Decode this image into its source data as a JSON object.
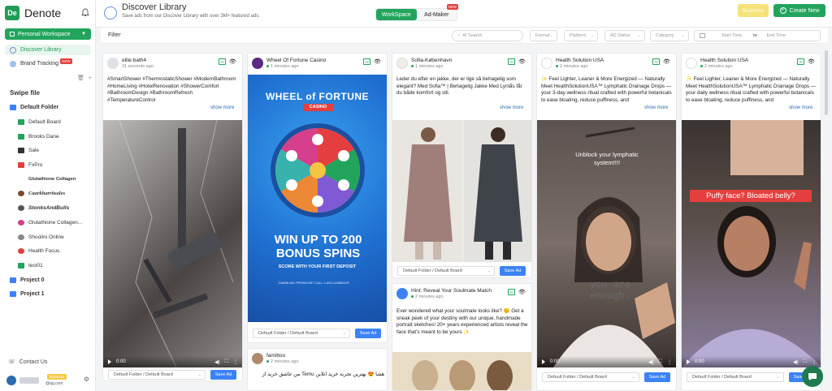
{
  "app": {
    "name": "Denote",
    "logo_text": "De"
  },
  "sidebar": {
    "workspace": "Personal Workspace",
    "nav": [
      {
        "label": "Discover Library",
        "active": true
      },
      {
        "label": "Brand Tracking",
        "badge": "NEW"
      }
    ],
    "swipe_title": "Swipe file",
    "folders": [
      {
        "label": "Default Folder",
        "bold": true,
        "color": "#3b82f6"
      },
      {
        "label": "Default Board",
        "color": "#22a45d"
      },
      {
        "label": "Brooks Dane",
        "color": "#22a45d"
      },
      {
        "label": "Sale",
        "color": "#333333"
      },
      {
        "label": "FxPro",
        "color": "#e53e3e"
      },
      {
        "label": "Glutathione Collagen",
        "color": "#ffffff"
      },
      {
        "label": "Caarkharritsales",
        "color": "#7c4a2d"
      },
      {
        "label": "StonksAndBulls",
        "color": "#555555"
      },
      {
        "label": "Glutathione Collagen...",
        "color": "#d53f8c"
      },
      {
        "label": "Shoolini Online",
        "color": "#888888"
      },
      {
        "label": "Health Focus",
        "color": "#e53e3e"
      },
      {
        "label": "test01",
        "color": "#22a45d"
      },
      {
        "label": "Project 0",
        "bold": true,
        "color": "#3b82f6"
      },
      {
        "label": "Project 1",
        "bold": true,
        "color": "#3b82f6"
      }
    ],
    "contact": "Contact Us",
    "user_badge": "Business",
    "user_email": "@qq.com"
  },
  "header": {
    "title": "Discover Library",
    "subtitle": "Save ads from our Discover Library with over 3M+ featured ads.",
    "seg_workspace": "WorkSpace",
    "seg_admaker": "Ad-Maker",
    "seg_badge": "NEW",
    "business_label": "Business",
    "create_label": "Create New"
  },
  "filters": {
    "label": "Filter",
    "search_placeholder": "AI Search",
    "format": "Format",
    "platform": "Platform",
    "status": "AD Status",
    "category": "Category",
    "start": "Start Time",
    "to": "to",
    "end": "End Time"
  },
  "cards": [
    {
      "name": "elite.bath4",
      "time": "31 seconds ago",
      "text": "#SmartShower #ThermostaticShower #ModernBathroom #HomeLiving #HotelRenovation #ShowerComfort #BathroomDesign #BathroomRefresh #TemperatureControl",
      "more": "show more",
      "video_time": "0:00",
      "folder": "Default Folder / Default Board",
      "save": "Save Ad"
    },
    {
      "name": "Wheel Of Fortune Casino",
      "time": "1 minutes ago",
      "banner_top": "WHEEL of FORTUNE",
      "banner_casino": "CASINO",
      "banner_main": "WIN UP TO 200 BONUS SPINS",
      "banner_sub": "SCORE WITH YOUR FIRST DEPOSIT",
      "banner_fine": "GAMBLING PROBLEM? CALL 1-800-GAMBLER",
      "folder": "Default Folder / Default Board",
      "save": "Save Ad"
    },
    {
      "name": "famittoo",
      "time": "2 minutes ago",
      "text": "هشا 😍 بهترین تجربه خرید آنلاین Temu من عاشق خرید از"
    },
    {
      "name": "Sofia-København",
      "time": "1 minutes ago",
      "text": "Leder du efter en jakke, der er lige så behagelig som elegant? Med Sofia™ | Behagelig Jakke Med Lynlås får du både komfort og stil.",
      "more": "show more",
      "folder": "Default Folder / Default Board",
      "save": "Save Ad"
    },
    {
      "name": "Hint: Reveal Your Soulmate Match",
      "time": "2 minutes ago",
      "text": "Ever wondered what your soulmate looks like? 😊 Get a sneak peek of your destiny with our unique, handmade portrait sketches! 20+ years experienced artists reveal the face that's meant to be yours ✨"
    },
    {
      "name": "Health Solution USA",
      "time": "2 minutes ago",
      "text": "✨ Feel Lighter, Leaner & More Energized — Naturally Meet HealthSolutionUSA™ Lymphatic Drainage Drops — your 3-day wellness ritual crafted with powerful botanicals to ease bloating, reduce puffiness, and",
      "more": "show more",
      "overlay": "Unblock your lymphatic system!!!!",
      "shirt": "you are enough.",
      "video_time": "0:00",
      "folder": "Default Folder / Default Board",
      "save": "Save Ad"
    },
    {
      "name": "Health Solution USA",
      "time": "2 minutes ago",
      "text": "✨ Feel Lighter, Leaner & More Energized — Naturally Meet HealthSolutionUSA™ Lymphatic Drainage Drops — your daily wellness ritual crafted with powerful botanicals to ease bloating, reduce puffiness, and",
      "more": "show more",
      "overlay": "Puffy face? Bloated belly?",
      "video_time": "0:00",
      "folder": "Default Folder / Default Board",
      "save": "Save Ad"
    }
  ],
  "common": {
    "ai": "AI",
    "eye": "👁"
  }
}
